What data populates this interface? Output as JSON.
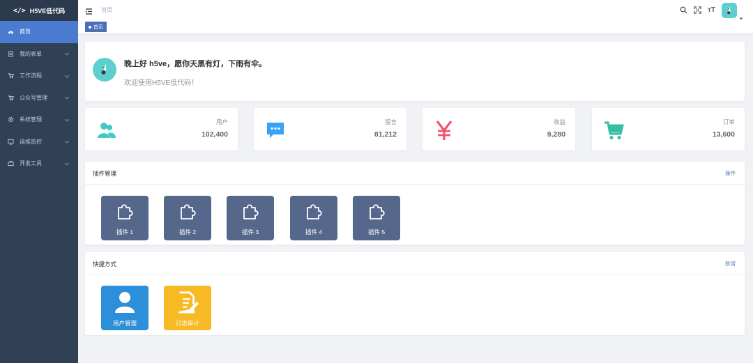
{
  "app": {
    "logo_text": "H5VE低代码",
    "logo_mark": "</>"
  },
  "sidebar": {
    "items": [
      {
        "label": "首页",
        "icon": "dashboard-icon",
        "active": true
      },
      {
        "label": "我的表单",
        "icon": "form-icon"
      },
      {
        "label": "工作流程",
        "icon": "cart-icon"
      },
      {
        "label": "公众号管理",
        "icon": "cart-icon"
      },
      {
        "label": "系统管理",
        "icon": "gear-icon"
      },
      {
        "label": "运维监控",
        "icon": "monitor-icon"
      },
      {
        "label": "开发工具",
        "icon": "toolbox-icon"
      }
    ]
  },
  "header": {
    "breadcrumb": "首页",
    "font_size_label": "тT"
  },
  "tags": {
    "active": "首页"
  },
  "welcome": {
    "greeting": "晚上好 h5ve，愿你天黑有灯，下雨有伞。",
    "subtitle": "欢迎使用H5VE低代码！"
  },
  "stats": [
    {
      "label": "用户",
      "value": "102,400",
      "icon": "users-icon",
      "color": "#40c9c6"
    },
    {
      "label": "留言",
      "value": "81,212",
      "icon": "message-icon",
      "color": "#36a3f7"
    },
    {
      "label": "收益",
      "value": "9,280",
      "icon": "yen-icon",
      "color": "#f4516c"
    },
    {
      "label": "订单",
      "value": "13,600",
      "icon": "shopping-cart-icon",
      "color": "#34bfa3"
    }
  ],
  "plugins": {
    "title": "插件管理",
    "action": "操作",
    "items": [
      {
        "label": "插件 1"
      },
      {
        "label": "插件 2"
      },
      {
        "label": "插件 3"
      },
      {
        "label": "插件 4"
      },
      {
        "label": "插件 5"
      }
    ]
  },
  "shortcuts": {
    "title": "快捷方式",
    "action": "新增",
    "items": [
      {
        "label": "用户管理",
        "icon": "user-icon",
        "color": "#2d8fd9"
      },
      {
        "label": "日志审计",
        "icon": "log-edit-icon",
        "color": "#f7b924"
      }
    ]
  }
}
